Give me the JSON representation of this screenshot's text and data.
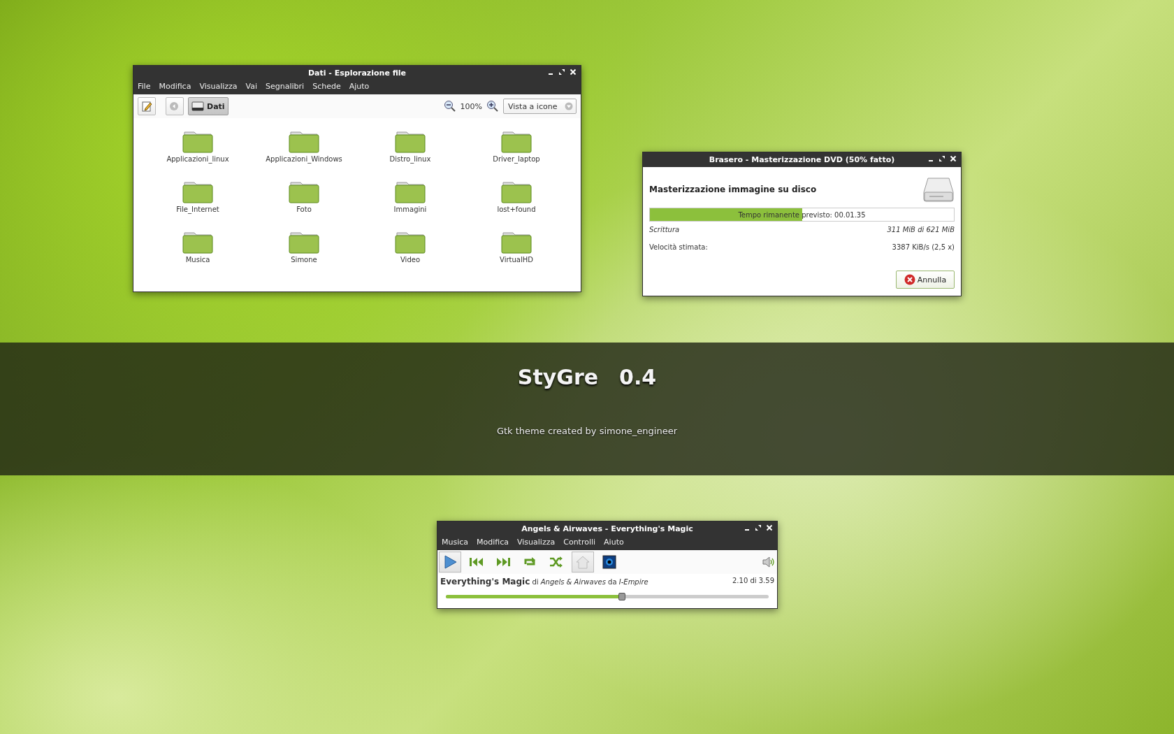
{
  "file_manager": {
    "title": "Dati - Esplorazione file",
    "menu": [
      "File",
      "Modifica",
      "Visualizza",
      "Vai",
      "Segnalibri",
      "Schede",
      "Ajuto"
    ],
    "location": "Dati",
    "zoom": "100%",
    "view": "Vista a icone",
    "folders": [
      "Applicazioni_linux",
      "Applicazioni_Windows",
      "Distro_linux",
      "Driver_laptop",
      "File_Internet",
      "Foto",
      "Immagini",
      "lost+found",
      "Musica",
      "Simone",
      "Video",
      "VirtualHD"
    ]
  },
  "burner": {
    "title": "Brasero - Masterizzazione DVD (50% fatto)",
    "heading": "Masterizzazione immagine su disco",
    "progress": {
      "level": 0.5,
      "label": "Tempo rimanente previsto: 00.01.35"
    },
    "rows": [
      {
        "label": "Scrittura",
        "value": "311 MiB di 621 MiB",
        "italic": true
      },
      {
        "label": "Velocità stimata:",
        "value": "3387 KiB/s (2,5 x)",
        "italic": false
      }
    ],
    "cancel": "Annulla"
  },
  "banner": {
    "name": "StyGre",
    "version": "0.4",
    "subtitle": "Gtk theme created by simone_engineer"
  },
  "player": {
    "title": "Angels & Airwaves - Everything's Magic",
    "menu": [
      "Musica",
      "Modifica",
      "Visualizza",
      "Controlli",
      "Aiuto"
    ],
    "controls": [
      {
        "kind": "play",
        "pressed": true
      },
      {
        "kind": "previous",
        "pressed": false
      },
      {
        "kind": "next",
        "pressed": false
      },
      {
        "kind": "repeat",
        "pressed": false
      },
      {
        "kind": "shuffle",
        "pressed": false
      },
      {
        "kind": "home",
        "pressed": true
      },
      {
        "kind": "visual",
        "pressed": false
      }
    ],
    "track": "**Everything's Magic** di *Angels & Airwaves* da *I-Empire*",
    "time": "2.10 di 3.59",
    "seek": {
      "level": 0.544
    }
  }
}
